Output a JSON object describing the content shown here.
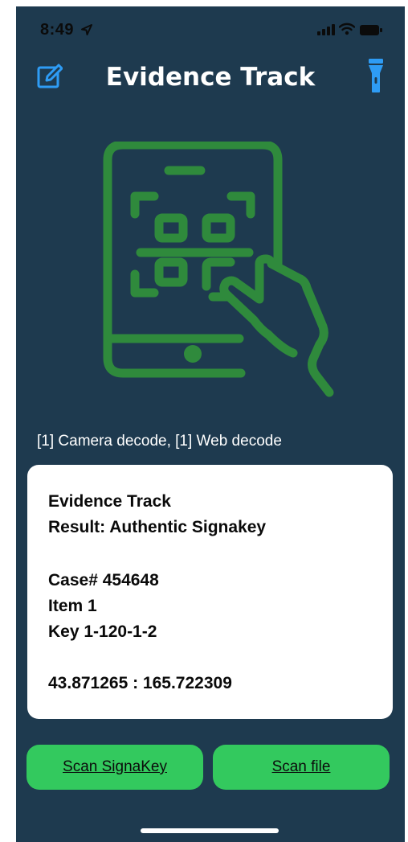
{
  "status_bar": {
    "time": "8:49"
  },
  "nav": {
    "title": "Evidence Track"
  },
  "decode_status": "[1] Camera decode, [1] Web decode",
  "result": {
    "lines": [
      "Evidence Track",
      "Result: Authentic Signakey",
      "Case# 454648",
      "Item 1",
      "Key 1-120-1-2",
      "43.871265 : 165.722309"
    ]
  },
  "buttons": {
    "scan_signakey": "Scan SignaKey",
    "scan_file": "Scan file"
  },
  "colors": {
    "background": "#1e3a4f",
    "accent_blue": "#2e9cf5",
    "illustration_green": "#2f8a3c",
    "button_green": "#33c95e",
    "card": "#ffffff"
  },
  "icons": {
    "edit": "edit-icon",
    "flashlight": "flashlight-icon",
    "illustration": "phone-qr-scan-illustration"
  }
}
